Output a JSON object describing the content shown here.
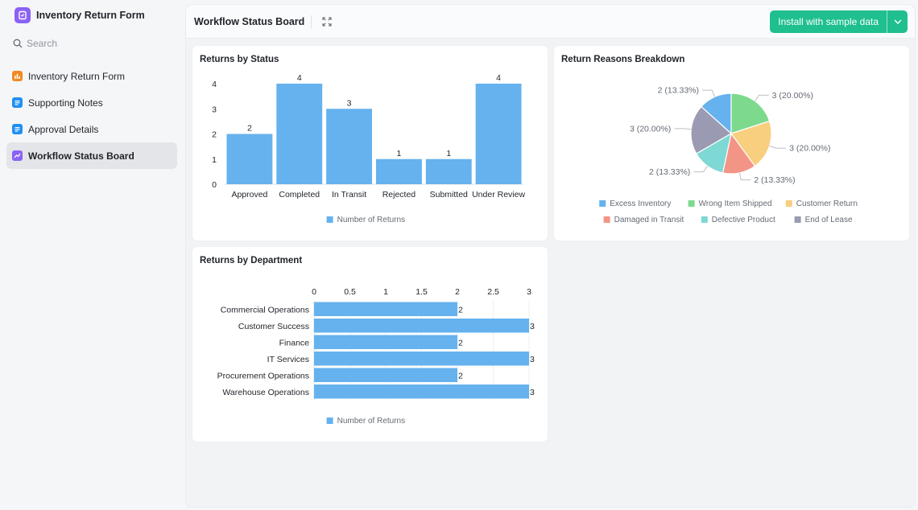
{
  "sidebar": {
    "app_title": "Inventory Return Form",
    "search_placeholder": "Search",
    "items": [
      {
        "label": "Inventory Return Form",
        "icon": "form-icon",
        "color": "#f08a24"
      },
      {
        "label": "Supporting Notes",
        "icon": "doc-icon",
        "color": "#1f8ff2"
      },
      {
        "label": "Approval Details",
        "icon": "doc-icon",
        "color": "#1f8ff2"
      },
      {
        "label": "Workflow Status Board",
        "icon": "dashboard-icon",
        "color": "#8b62f5"
      }
    ],
    "active_index": 3
  },
  "header": {
    "title": "Workflow Status Board",
    "install_label": "Install with sample data",
    "accent": "#1fbf8f"
  },
  "chart_data": [
    {
      "type": "bar",
      "title": "Returns by Status",
      "categories": [
        "Approved",
        "Completed",
        "In Transit",
        "Rejected",
        "Submitted",
        "Under Review"
      ],
      "series": [
        {
          "name": "Number of Returns",
          "values": [
            2,
            4,
            3,
            1,
            1,
            4
          ],
          "color": "#65b2ee"
        }
      ],
      "yticks": [
        "0",
        "1",
        "2",
        "3",
        "4"
      ],
      "ylim": [
        0,
        4
      ],
      "legend": "bottom"
    },
    {
      "type": "pie",
      "title": "Return Reasons Breakdown",
      "slices": [
        {
          "name": "Excess Inventory",
          "value": 2,
          "label": "2 (13.33%)",
          "color": "#65b2ee"
        },
        {
          "name": "Wrong Item Shipped",
          "value": 3,
          "label": "3 (20.00%)",
          "color": "#7dd98c"
        },
        {
          "name": "Customer Return",
          "value": 3,
          "label": "3 (20.00%)",
          "color": "#f8cf7f"
        },
        {
          "name": "Damaged in Transit",
          "value": 2,
          "label": "2 (13.33%)",
          "color": "#f29586"
        },
        {
          "name": "Defective Product",
          "value": 2,
          "label": "2 (13.33%)",
          "color": "#7ed8d4"
        },
        {
          "name": "End of Lease",
          "value": 3,
          "label": "3 (20.00%)",
          "color": "#9a9bb3"
        }
      ],
      "legend": "bottom"
    },
    {
      "type": "bar",
      "orientation": "horizontal",
      "title": "Returns by Department",
      "categories": [
        "Commercial Operations",
        "Customer Success",
        "Finance",
        "IT Services",
        "Procurement Operations",
        "Warehouse Operations"
      ],
      "series": [
        {
          "name": "Number of Returns",
          "values": [
            2,
            3,
            2,
            3,
            2,
            3
          ],
          "color": "#65b2ee"
        }
      ],
      "xticks": [
        "0",
        "0.5",
        "1",
        "1.5",
        "2",
        "2.5",
        "3"
      ],
      "xlim": [
        0,
        3
      ],
      "legend": "bottom"
    }
  ]
}
